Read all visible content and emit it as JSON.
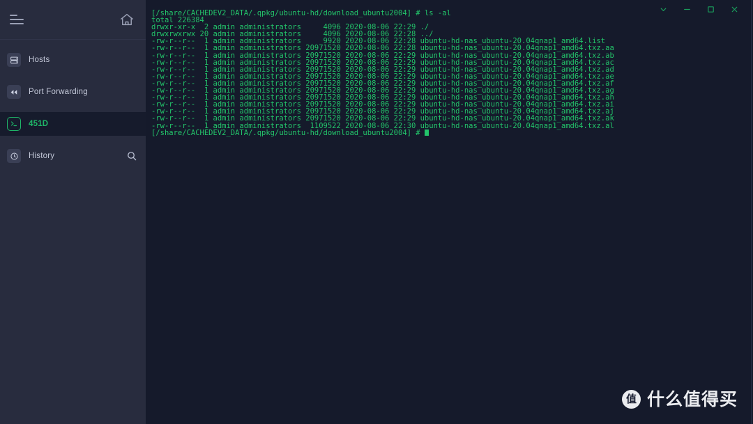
{
  "sidebar": {
    "menu_icon": "hamburger-icon",
    "home_icon": "home-icon",
    "items": [
      {
        "label": "Hosts",
        "icon": "server-icon",
        "active": false
      },
      {
        "label": "Port Forwarding",
        "icon": "double-arrow-icon",
        "active": false
      },
      {
        "label": "451D",
        "icon": "terminal-icon",
        "active": true
      },
      {
        "label": "History",
        "icon": "clock-icon",
        "active": false,
        "trailing_icon": "search-icon"
      }
    ]
  },
  "titlebar": {
    "buttons": [
      {
        "name": "chevron-down-button",
        "label": "v"
      },
      {
        "name": "minimize-button",
        "label": "-"
      },
      {
        "name": "maximize-button",
        "label": "[]"
      },
      {
        "name": "close-button",
        "label": "x"
      }
    ]
  },
  "terminal": {
    "prompt_path": "[/share/CACHEDEV2_DATA/.qpkg/ubuntu-hd/download_ubuntu2004]",
    "lines": [
      "[/share/CACHEDEV2_DATA/.qpkg/ubuntu-hd/download_ubuntu2004] # ls -al",
      "total 226384",
      "drwxr-xr-x  2 admin administrators     4096 2020-08-06 22:29 ./",
      "drwxrwxrwx 20 admin administrators     4096 2020-08-06 22:28 ../",
      "-rw-r--r--  1 admin administrators     9920 2020-08-06 22:28 ubuntu-hd-nas_ubuntu-20.04qnap1_amd64.list",
      "-rw-r--r--  1 admin administrators 20971520 2020-08-06 22:28 ubuntu-hd-nas_ubuntu-20.04qnap1_amd64.txz.aa",
      "-rw-r--r--  1 admin administrators 20971520 2020-08-06 22:29 ubuntu-hd-nas_ubuntu-20.04qnap1_amd64.txz.ab",
      "-rw-r--r--  1 admin administrators 20971520 2020-08-06 22:29 ubuntu-hd-nas_ubuntu-20.04qnap1_amd64.txz.ac",
      "-rw-r--r--  1 admin administrators 20971520 2020-08-06 22:29 ubuntu-hd-nas_ubuntu-20.04qnap1_amd64.txz.ad",
      "-rw-r--r--  1 admin administrators 20971520 2020-08-06 22:29 ubuntu-hd-nas_ubuntu-20.04qnap1_amd64.txz.ae",
      "-rw-r--r--  1 admin administrators 20971520 2020-08-06 22:29 ubuntu-hd-nas_ubuntu-20.04qnap1_amd64.txz.af",
      "-rw-r--r--  1 admin administrators 20971520 2020-08-06 22:29 ubuntu-hd-nas_ubuntu-20.04qnap1_amd64.txz.ag",
      "-rw-r--r--  1 admin administrators 20971520 2020-08-06 22:29 ubuntu-hd-nas_ubuntu-20.04qnap1_amd64.txz.ah",
      "-rw-r--r--  1 admin administrators 20971520 2020-08-06 22:29 ubuntu-hd-nas_ubuntu-20.04qnap1_amd64.txz.ai",
      "-rw-r--r--  1 admin administrators 20971520 2020-08-06 22:29 ubuntu-hd-nas_ubuntu-20.04qnap1_amd64.txz.aj",
      "-rw-r--r--  1 admin administrators 20971520 2020-08-06 22:29 ubuntu-hd-nas_ubuntu-20.04qnap1_amd64.txz.ak",
      "-rw-r--r--  1 admin administrators  1109522 2020-08-06 22:30 ubuntu-hd-nas_ubuntu-20.04qnap1_amd64.txz.al"
    ],
    "last_prompt": "[/share/CACHEDEV2_DATA/.qpkg/ubuntu-hd/download_ubuntu2004] # "
  },
  "watermark": {
    "logo_char": "值",
    "text": "什么值得买"
  },
  "colors": {
    "sidebar_bg": "#282c3e",
    "terminal_bg": "#151a2b",
    "accent_green": "#23c46a",
    "active_row_bg": "#161b2c",
    "label_gray": "#c3c8d8"
  }
}
